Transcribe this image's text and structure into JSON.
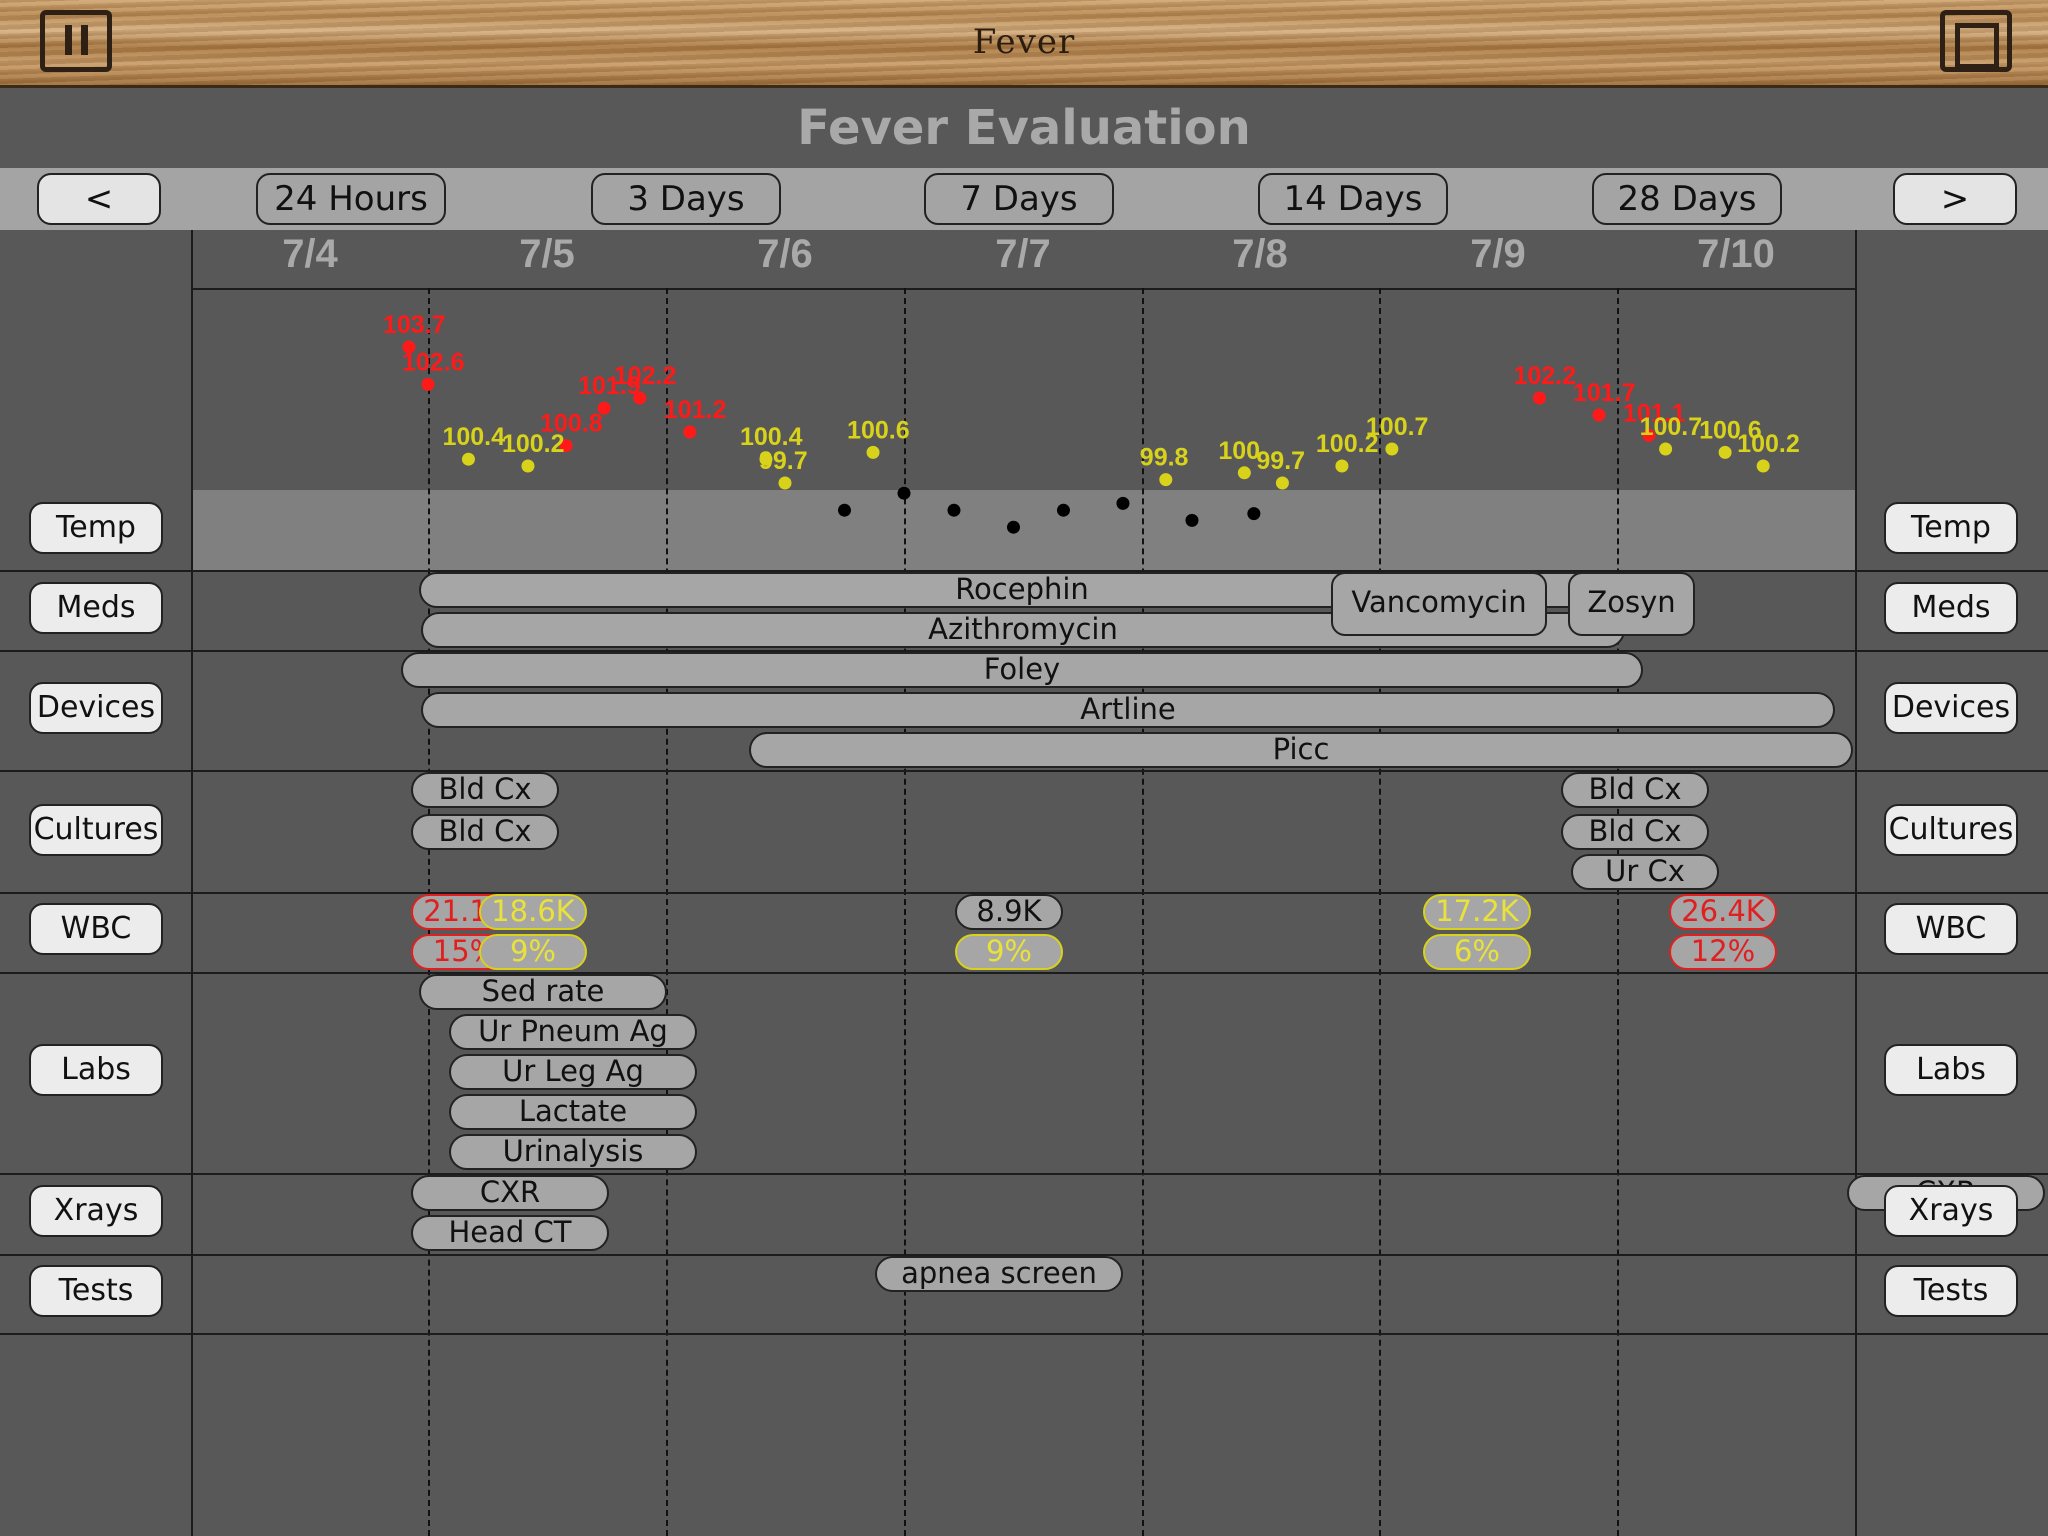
{
  "app": {
    "title": "Fever"
  },
  "page": {
    "heading": "Fever Evaluation"
  },
  "range": {
    "prev": "<",
    "next": ">",
    "options": [
      "24 Hours",
      "3 Days",
      "7 Days",
      "14 Days",
      "28 Days"
    ]
  },
  "dates": [
    "7/4",
    "7/5",
    "7/6",
    "7/7",
    "7/8",
    "7/9",
    "7/10"
  ],
  "rows": {
    "temp": "Temp",
    "meds": "Meds",
    "devices": "Devices",
    "cultures": "Cultures",
    "wbc": "WBC",
    "labs": "Labs",
    "xrays": "Xrays",
    "tests": "Tests"
  },
  "meds": [
    "Rocephin",
    "Azithromycin",
    "Vancomycin",
    "Zosyn"
  ],
  "devices": [
    "Foley",
    "Artline",
    "Picc"
  ],
  "cultures": [
    "Bld Cx",
    "Bld Cx",
    "Bld Cx",
    "Bld Cx",
    "Ur Cx"
  ],
  "wbc": {
    "counts": [
      "21.1K",
      "18.6K",
      "8.9K",
      "17.2K",
      "26.4K"
    ],
    "percents": [
      "15%",
      "9%",
      "9%",
      "6%",
      "12%"
    ]
  },
  "labs": [
    "Sed rate",
    "Ur Pneum Ag",
    "Ur Leg Ag",
    "Lactate",
    "Urinalysis"
  ],
  "xrays": [
    "CXR",
    "Head CT",
    "CXR"
  ],
  "tests": [
    "apnea screen"
  ],
  "colors": {
    "fever_high": "#ff1a1a",
    "fever_low": "#d8d21a",
    "normal": "#000000"
  },
  "chart_data": {
    "type": "scatter",
    "title": "",
    "x_unit": "day",
    "series": [
      {
        "color": "#ff1a1a",
        "points": [
          {
            "x": 4.92,
            "y": 103.7
          },
          {
            "x": 5.0,
            "y": 102.6
          },
          {
            "x": 5.58,
            "y": 100.8
          },
          {
            "x": 5.74,
            "y": 101.9
          },
          {
            "x": 5.89,
            "y": 102.2
          },
          {
            "x": 6.1,
            "y": 101.2
          },
          {
            "x": 9.67,
            "y": 102.2
          },
          {
            "x": 9.92,
            "y": 101.7
          },
          {
            "x": 10.13,
            "y": 101.1
          }
        ]
      },
      {
        "color": "#d8d21a",
        "points": [
          {
            "x": 5.17,
            "y": 100.4
          },
          {
            "x": 5.42,
            "y": 100.2
          },
          {
            "x": 6.42,
            "y": 100.4
          },
          {
            "x": 6.5,
            "y": 99.7
          },
          {
            "x": 6.87,
            "y": 100.6
          },
          {
            "x": 8.1,
            "y": 99.8
          },
          {
            "x": 8.43,
            "y": 100.0
          },
          {
            "x": 8.59,
            "y": 99.7
          },
          {
            "x": 8.84,
            "y": 100.2
          },
          {
            "x": 9.05,
            "y": 100.7
          },
          {
            "x": 10.2,
            "y": 100.7
          },
          {
            "x": 10.45,
            "y": 100.6
          },
          {
            "x": 10.61,
            "y": 100.2
          }
        ]
      },
      {
        "color": "#000000",
        "points": [
          {
            "x": 6.75,
            "y": 98.9
          },
          {
            "x": 7.0,
            "y": 99.4
          },
          {
            "x": 7.21,
            "y": 98.9
          },
          {
            "x": 7.46,
            "y": 98.4
          },
          {
            "x": 7.67,
            "y": 98.9
          },
          {
            "x": 7.92,
            "y": 99.1
          },
          {
            "x": 8.21,
            "y": 98.6
          },
          {
            "x": 8.47,
            "y": 98.8
          }
        ]
      }
    ]
  }
}
